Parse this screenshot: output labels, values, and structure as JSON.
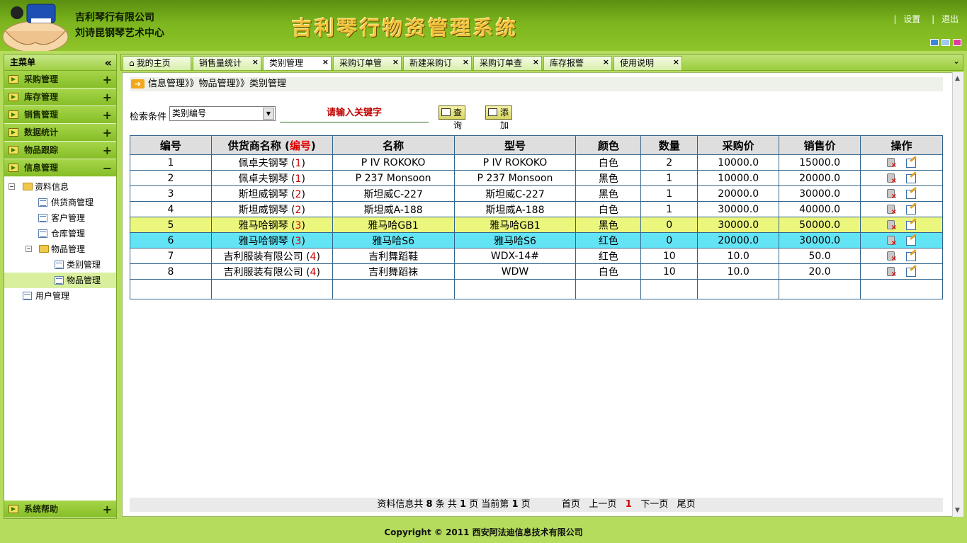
{
  "header": {
    "company_line1": "吉利琴行有限公司",
    "company_line2": "刘诗昆钢琴艺术中心",
    "app_title": "吉利琴行物资管理系统",
    "settings_link": "设置",
    "logout_link": "退出"
  },
  "sidebar": {
    "title": "主菜单",
    "collapse_glyph": "«",
    "items": [
      {
        "label": "采购管理",
        "toggle": "+"
      },
      {
        "label": "库存管理",
        "toggle": "+"
      },
      {
        "label": "销售管理",
        "toggle": "+"
      },
      {
        "label": "数据统计",
        "toggle": "+"
      },
      {
        "label": "物品跟踪",
        "toggle": "+"
      },
      {
        "label": "信息管理",
        "toggle": "−"
      }
    ],
    "tree": {
      "root": "资料信息",
      "supplier": "供货商管理",
      "customer": "客户管理",
      "warehouse": "仓库管理",
      "goods_group": "物品管理",
      "category": "类别管理",
      "goods": "物品管理",
      "user": "用户管理"
    },
    "help": {
      "label": "系统帮助",
      "toggle": "+"
    }
  },
  "tabs": [
    {
      "label": "我的主页"
    },
    {
      "label": "销售量统计"
    },
    {
      "label": "类别管理"
    },
    {
      "label": "采购订单管"
    },
    {
      "label": "新建采购订"
    },
    {
      "label": "采购订单查"
    },
    {
      "label": "库存报警"
    },
    {
      "label": "使用说明"
    }
  ],
  "breadcrumb": "信息管理》》物品管理》》类别管理",
  "search": {
    "label": "检索条件",
    "selected": "类别编号",
    "keyword_placeholder": "请输入关键字",
    "query_button": "查询",
    "add_button": "添加"
  },
  "table": {
    "headers": {
      "id": "编号",
      "supplier": "供货商名称",
      "supplier_code": "编号",
      "name": "名称",
      "model": "型号",
      "color": "颜色",
      "qty": "数量",
      "purchase": "采购价",
      "sale": "销售价",
      "ops": "操作"
    },
    "rows": [
      {
        "id": "1",
        "supplier": "佩卓夫钢琴",
        "code": "1",
        "name": "P IV ROKOKO",
        "model": "P IV ROKOKO",
        "color": "白色",
        "qty": "2",
        "purchase": "10000.0",
        "sale": "15000.0"
      },
      {
        "id": "2",
        "supplier": "佩卓夫钢琴",
        "code": "1",
        "name": "P 237 Monsoon",
        "model": "P 237 Monsoon",
        "color": "黑色",
        "qty": "1",
        "purchase": "10000.0",
        "sale": "20000.0"
      },
      {
        "id": "3",
        "supplier": "斯坦威钢琴",
        "code": "2",
        "name": "斯坦威C-227",
        "model": "斯坦威C-227",
        "color": "黑色",
        "qty": "1",
        "purchase": "20000.0",
        "sale": "30000.0"
      },
      {
        "id": "4",
        "supplier": "斯坦威钢琴",
        "code": "2",
        "name": "斯坦威A-188",
        "model": "斯坦威A-188",
        "color": "白色",
        "qty": "1",
        "purchase": "30000.0",
        "sale": "40000.0"
      },
      {
        "id": "5",
        "supplier": "雅马哈钢琴",
        "code": "3",
        "name": "雅马哈GB1",
        "model": "雅马哈GB1",
        "color": "黑色",
        "qty": "0",
        "purchase": "30000.0",
        "sale": "50000.0"
      },
      {
        "id": "6",
        "supplier": "雅马哈钢琴",
        "code": "3",
        "name": "雅马哈S6",
        "model": "雅马哈S6",
        "color": "红色",
        "qty": "0",
        "purchase": "20000.0",
        "sale": "30000.0"
      },
      {
        "id": "7",
        "supplier": "吉利服装有限公司",
        "code": "4",
        "name": "吉利舞蹈鞋",
        "model": "WDX-14#",
        "color": "红色",
        "qty": "10",
        "purchase": "10.0",
        "sale": "50.0"
      },
      {
        "id": "8",
        "supplier": "吉利服装有限公司",
        "code": "4",
        "name": "吉利舞蹈袜",
        "model": "WDW",
        "color": "白色",
        "qty": "10",
        "purchase": "10.0",
        "sale": "20.0"
      }
    ]
  },
  "pager": {
    "t1": "资料信息共",
    "total": "8",
    "t2": "条 共",
    "pages": "1",
    "t3": "页 当前第",
    "current": "1",
    "t4": "页",
    "first": "首页",
    "prev": "上一页",
    "page_num": "1",
    "next": "下一页",
    "last": "尾页"
  },
  "footer": "Copyright © 2011 西安阿法迪信息技术有限公司",
  "colors": {
    "accent_green": "#8fc52a",
    "row_highlight": "#ebf67d",
    "row_current": "#62e4f5",
    "keyword_red": "#c00000"
  }
}
